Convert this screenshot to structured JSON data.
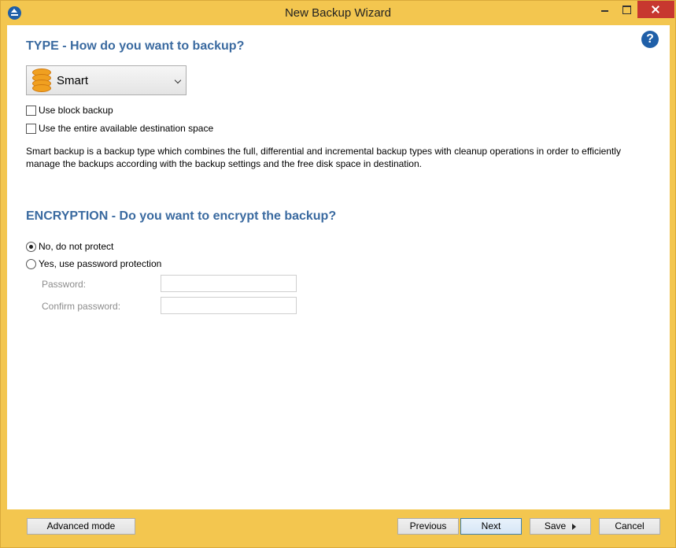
{
  "window": {
    "title": "New Backup Wizard"
  },
  "type_section": {
    "title": "TYPE - How do you want to backup?",
    "backup_type": "Smart",
    "use_block_backup": "Use block backup",
    "use_entire_space": "Use the entire available destination space",
    "description": "Smart backup is a backup type which combines the full, differential and incremental backup types with cleanup operations in order to efficiently manage the backups according with the backup settings and the free disk space in destination."
  },
  "encryption_section": {
    "title": "ENCRYPTION - Do you want to encrypt the backup?",
    "option_no": "No, do not protect",
    "option_yes": "Yes, use password protection",
    "password_label": "Password:",
    "confirm_label": "Confirm password:",
    "selected": "no"
  },
  "footer": {
    "advanced_mode": "Advanced mode",
    "previous": "Previous",
    "next": "Next",
    "save": "Save",
    "cancel": "Cancel"
  },
  "colors": {
    "frame": "#f3c64f",
    "section_title": "#3a6aa0",
    "close_button": "#c7372f",
    "help_icon": "#1f5fa8"
  },
  "icons": {
    "app": "backup-app-icon",
    "help": "help-icon",
    "type": "database-icon",
    "save_menu": "triangle-right-icon"
  }
}
